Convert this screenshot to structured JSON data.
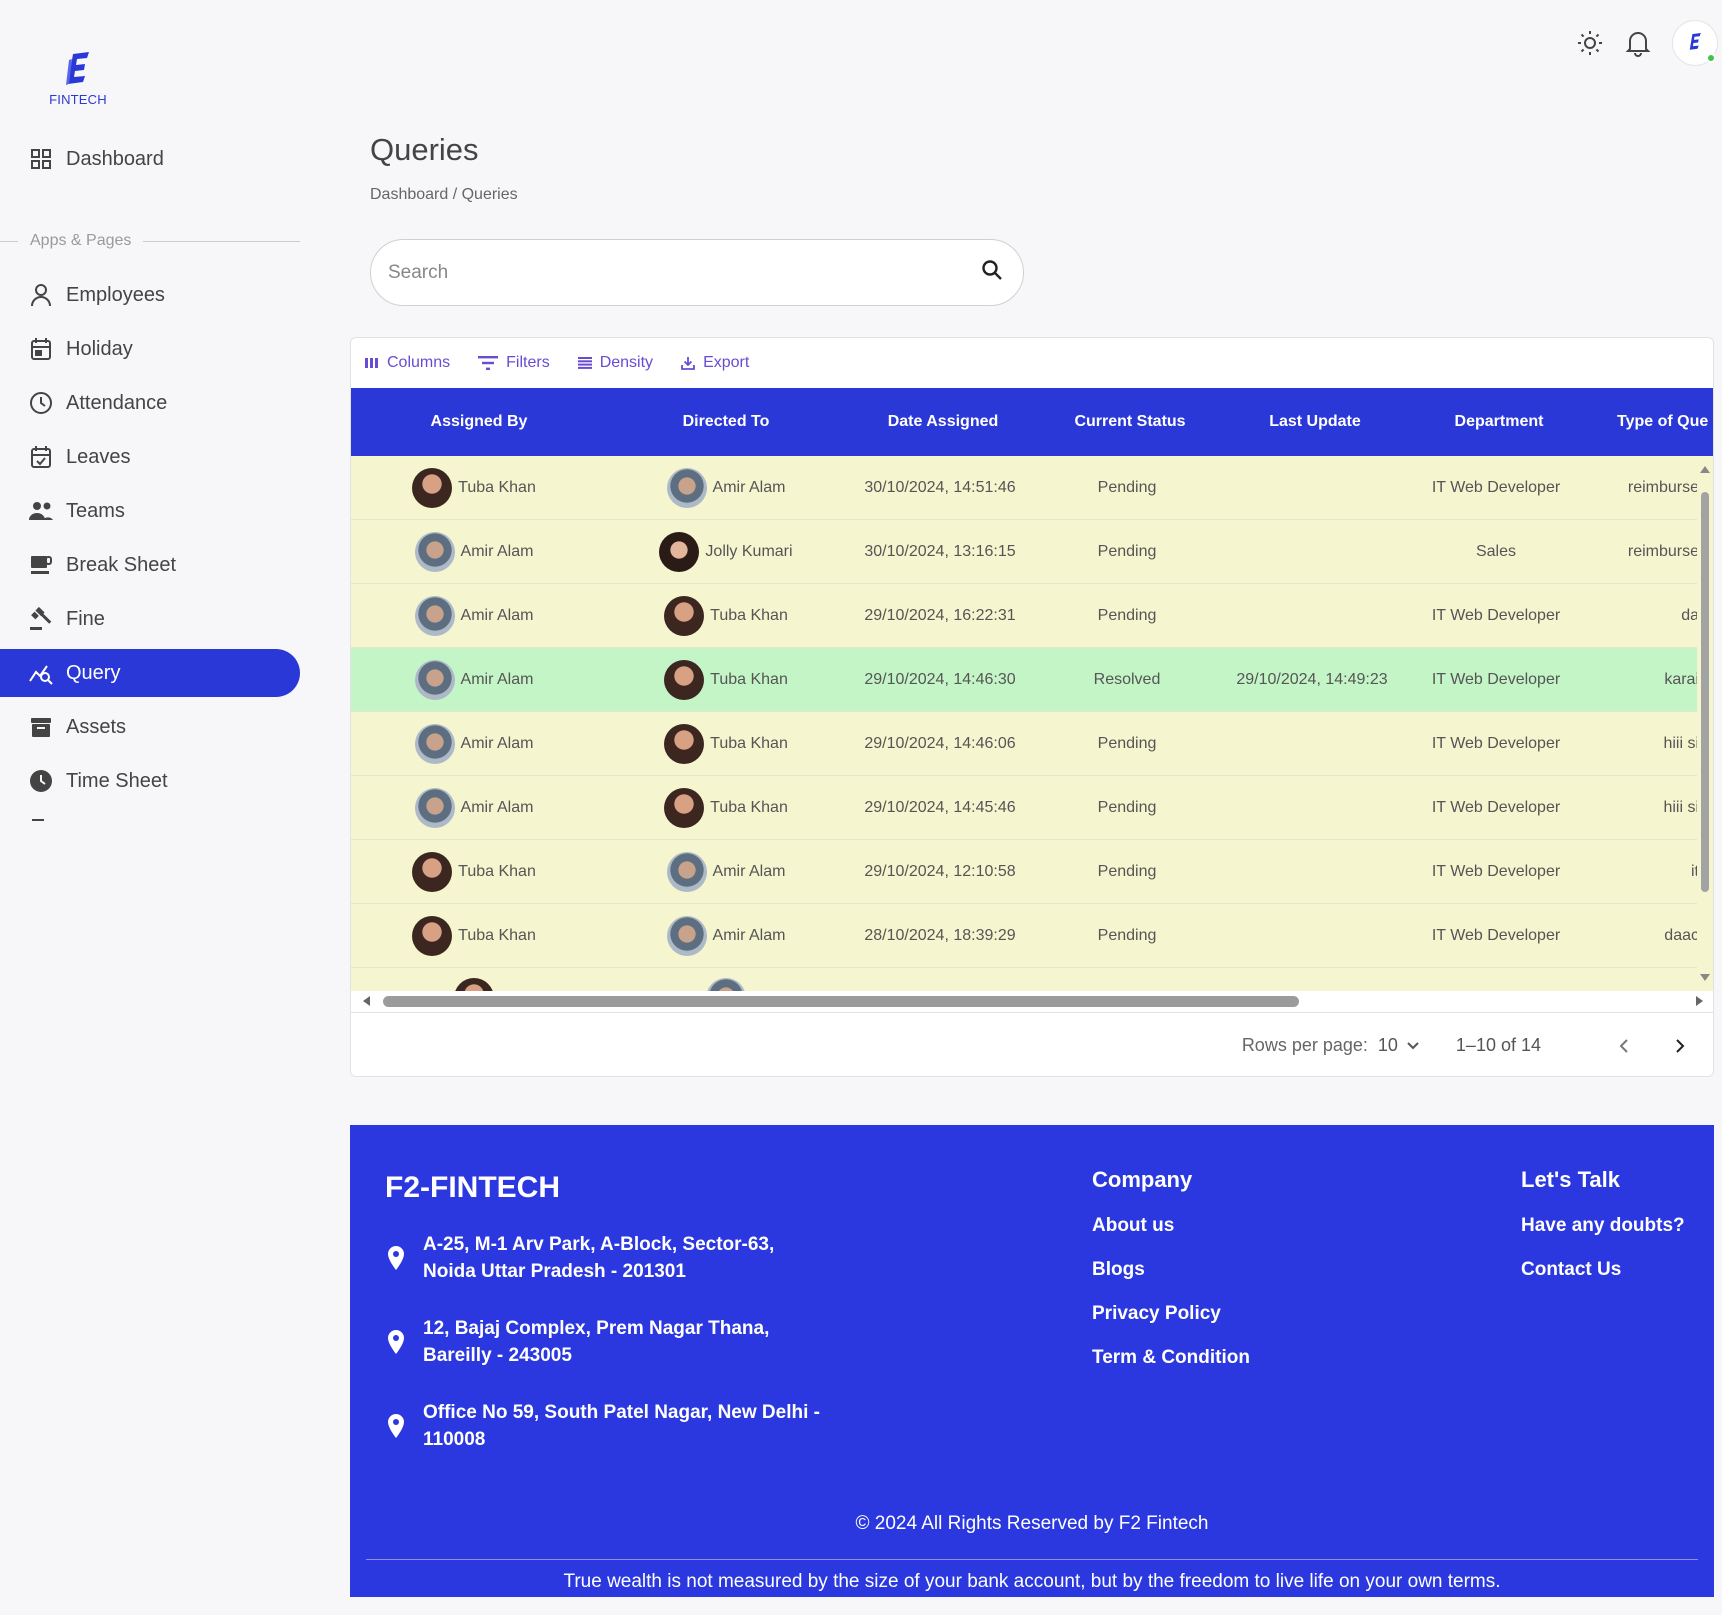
{
  "brand": {
    "logo_text": "FINTECH"
  },
  "sidebar": {
    "dashboard_label": "Dashboard",
    "section_label": "Apps & Pages",
    "items": [
      {
        "label": "Employees",
        "icon": "person-icon"
      },
      {
        "label": "Holiday",
        "icon": "calendar-icon"
      },
      {
        "label": "Attendance",
        "icon": "clock-icon"
      },
      {
        "label": "Leaves",
        "icon": "calendar-check-icon"
      },
      {
        "label": "Teams",
        "icon": "group-icon"
      },
      {
        "label": "Break Sheet",
        "icon": "coffee-icon"
      },
      {
        "label": "Fine",
        "icon": "gavel-icon"
      },
      {
        "label": "Query",
        "icon": "query-chart-icon"
      },
      {
        "label": "Assets",
        "icon": "archive-icon"
      },
      {
        "label": "Time Sheet",
        "icon": "clock-filled-icon"
      }
    ],
    "active_item": "Query"
  },
  "header": {
    "title": "Queries",
    "breadcrumb": "Dashboard / Queries",
    "search_placeholder": "Search"
  },
  "toolbar": {
    "columns": "Columns",
    "filters": "Filters",
    "density": "Density",
    "export": "Export"
  },
  "table": {
    "columns": [
      "Assigned By",
      "Directed To",
      "Date Assigned",
      "Current Status",
      "Last Update",
      "Department",
      "Type of Que"
    ],
    "rows": [
      {
        "assigned_by": "Tuba Khan",
        "directed_to": "Amir Alam",
        "date_assigned": "30/10/2024, 14:51:46",
        "status": "Pending",
        "last_update": "",
        "department": "IT Web Developer",
        "type": "reimburse"
      },
      {
        "assigned_by": "Amir Alam",
        "directed_to": "Jolly Kumari",
        "date_assigned": "30/10/2024, 13:16:15",
        "status": "Pending",
        "last_update": "",
        "department": "Sales",
        "type": "reimburse"
      },
      {
        "assigned_by": "Amir Alam",
        "directed_to": "Tuba Khan",
        "date_assigned": "29/10/2024, 16:22:31",
        "status": "Pending",
        "last_update": "",
        "department": "IT Web Developer",
        "type": "da"
      },
      {
        "assigned_by": "Amir Alam",
        "directed_to": "Tuba Khan",
        "date_assigned": "29/10/2024, 14:46:30",
        "status": "Resolved",
        "last_update": "29/10/2024, 14:49:23",
        "department": "IT Web Developer",
        "type": "karai"
      },
      {
        "assigned_by": "Amir Alam",
        "directed_to": "Tuba Khan",
        "date_assigned": "29/10/2024, 14:46:06",
        "status": "Pending",
        "last_update": "",
        "department": "IT Web Developer",
        "type": "hiii si"
      },
      {
        "assigned_by": "Amir Alam",
        "directed_to": "Tuba Khan",
        "date_assigned": "29/10/2024, 14:45:46",
        "status": "Pending",
        "last_update": "",
        "department": "IT Web Developer",
        "type": "hiii si"
      },
      {
        "assigned_by": "Tuba Khan",
        "directed_to": "Amir Alam",
        "date_assigned": "29/10/2024, 12:10:58",
        "status": "Pending",
        "last_update": "",
        "department": "IT Web Developer",
        "type": "it"
      },
      {
        "assigned_by": "Tuba Khan",
        "directed_to": "Amir Alam",
        "date_assigned": "28/10/2024, 18:39:29",
        "status": "Pending",
        "last_update": "",
        "department": "IT Web Developer",
        "type": "daac"
      }
    ],
    "colors": {
      "pending_row": "#f5f6cf",
      "resolved_row": "#c4f5c7",
      "header_bg": "#2b38d8"
    }
  },
  "pagination": {
    "rows_per_page_label": "Rows per page:",
    "rows_per_page_value": "10",
    "range": "1–10 of 14"
  },
  "footer": {
    "brand": "F2-FINTECH",
    "addresses": [
      {
        "line1": "A-25, M-1 Arv Park, A-Block, Sector-63,",
        "line2": "Noida Uttar Pradesh - 201301"
      },
      {
        "line1": "12, Bajaj Complex, Prem Nagar Thana,",
        "line2": "Bareilly - 243005"
      },
      {
        "line1": "Office No 59, South Patel Nagar, New Delhi -",
        "line2": "110008"
      }
    ],
    "company_heading": "Company",
    "company_links": [
      "About us",
      "Blogs",
      "Privacy Policy",
      "Term & Condition"
    ],
    "talk_heading": "Let's Talk",
    "talk_links": [
      "Have any doubts?",
      "Contact Us"
    ],
    "copyright": "© 2024 All Rights Reserved by F2 Fintech",
    "quote": "True wealth is not measured by the size of your bank account, but by the freedom to live life on your own terms.",
    "bg_color": "#2b38df"
  }
}
